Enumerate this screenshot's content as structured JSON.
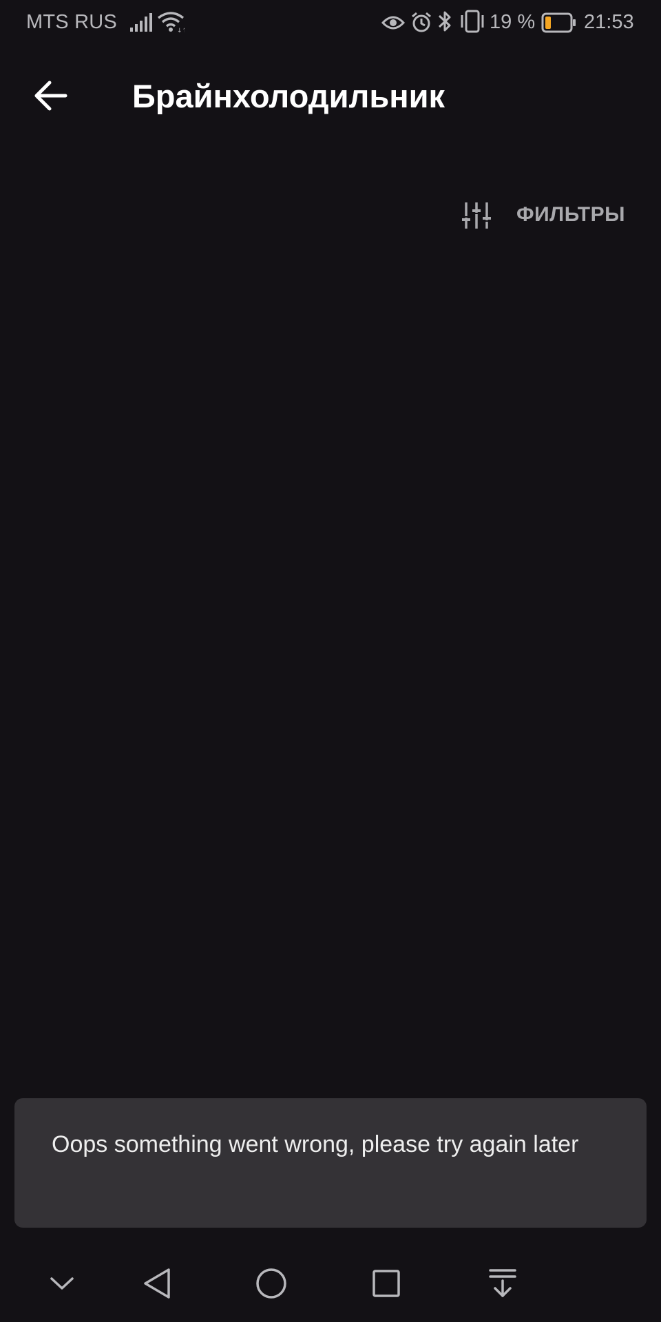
{
  "status_bar": {
    "carrier": "MTS RUS",
    "battery_percent": "19 %",
    "time": "21:53",
    "icons": [
      "signal-icon",
      "wifi-icon",
      "eye-icon",
      "alarm-icon",
      "bluetooth-icon",
      "vibrate-icon",
      "battery-icon"
    ],
    "battery_level": 0.19,
    "battery_color": "#f5a623"
  },
  "app_bar": {
    "title": "Брайнхолодильник",
    "back_icon": "arrow-left-icon"
  },
  "filters": {
    "label": "ФИЛЬТРЫ",
    "icon": "sliders-icon"
  },
  "snackbar": {
    "message": "Oops something went wrong, please try again later"
  },
  "nav_bar": {
    "icons": [
      "chevron-down-icon",
      "back-triangle-icon",
      "home-circle-icon",
      "recents-square-icon",
      "notification-pull-icon"
    ]
  },
  "colors": {
    "background": "#131115",
    "snackbar": "#343236",
    "text_primary": "#ffffff",
    "text_secondary": "#a9a9ad"
  }
}
